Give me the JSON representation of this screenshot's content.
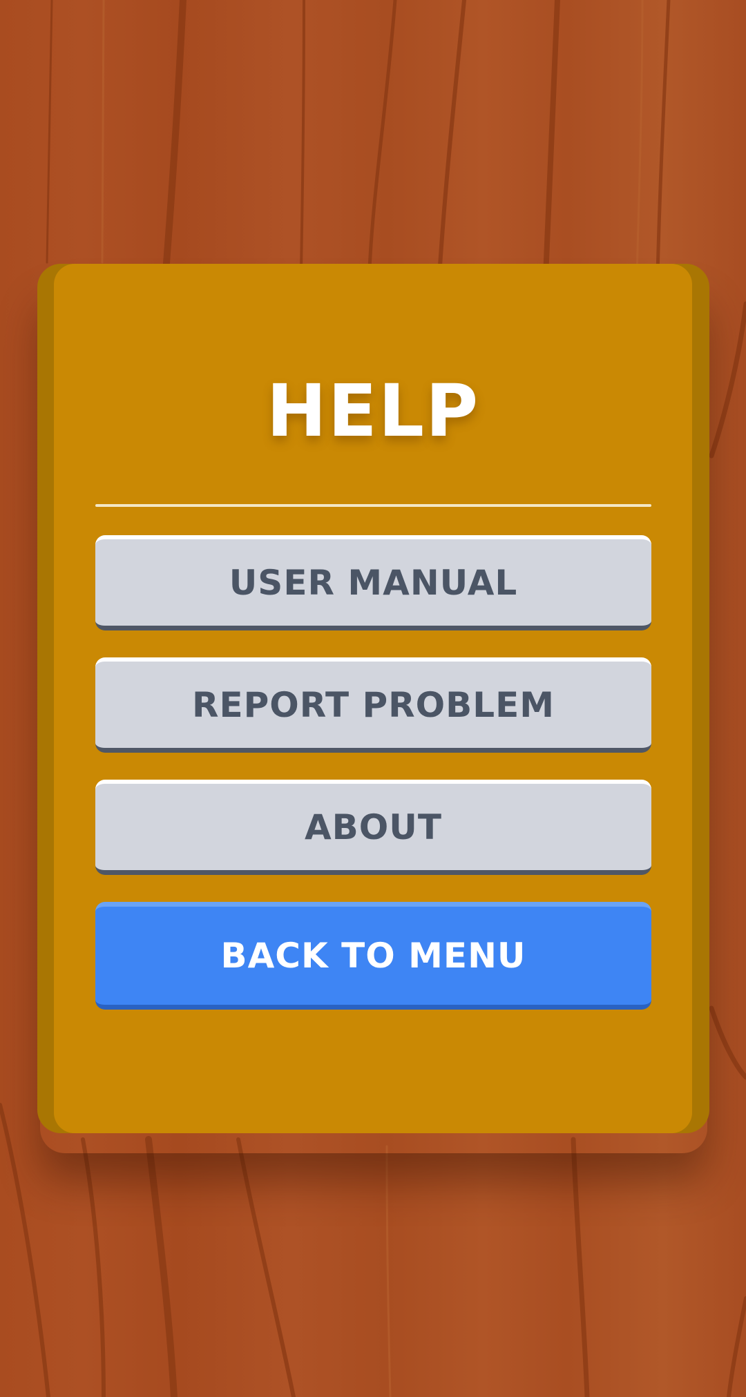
{
  "dialog": {
    "title": "HELP",
    "buttons": [
      {
        "label": "USER MANUAL"
      },
      {
        "label": "REPORT PROBLEM"
      },
      {
        "label": "ABOUT"
      }
    ],
    "back_label": "BACK TO MENU"
  },
  "colors": {
    "background_wood": "#a94d21",
    "panel": "#ca8904",
    "panel_edge": "#a97603",
    "button_gray": "#d2d5dd",
    "button_gray_text": "#4b5565",
    "button_blue": "#3e85f4",
    "title_text": "#ffffff"
  }
}
